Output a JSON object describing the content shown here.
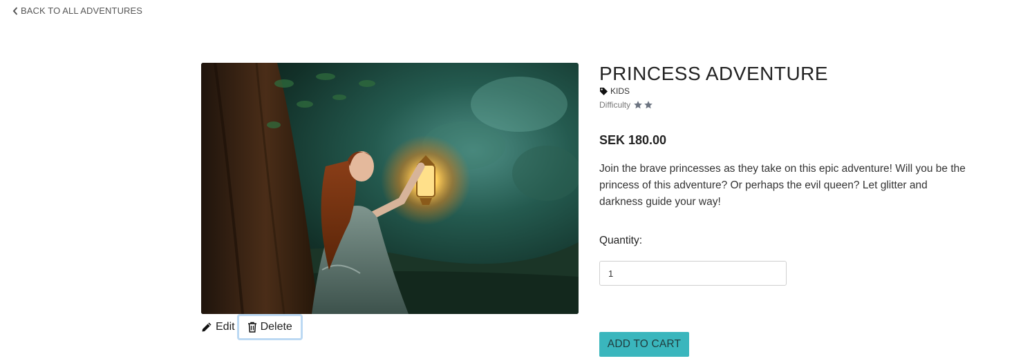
{
  "nav": {
    "back_label": "BACK TO ALL ADVENTURES"
  },
  "product": {
    "title": "PRINCESS ADVENTURE",
    "category": "KIDS",
    "difficulty_label": "Difficulty",
    "difficulty_stars": 2,
    "price": "SEK 180.00",
    "description": "Join the brave princesses as they take on this epic adventure! Will you be the princess of this adventure? Or perhaps the evil queen? Let glitter and darkness guide your way!"
  },
  "admin": {
    "edit_label": "Edit",
    "delete_label": "Delete"
  },
  "form": {
    "quantity_label": "Quantity:",
    "quantity_value": "1",
    "add_to_cart_label": "ADD TO CART"
  },
  "colors": {
    "accent": "#3ab6bd",
    "focus_ring": "#bcd9f3",
    "star": "#6c7481"
  },
  "icons": {
    "back": "chevron-left-icon",
    "category": "tag-icon",
    "difficulty": "star-icon",
    "edit": "pencil-icon",
    "delete": "trash-icon"
  }
}
